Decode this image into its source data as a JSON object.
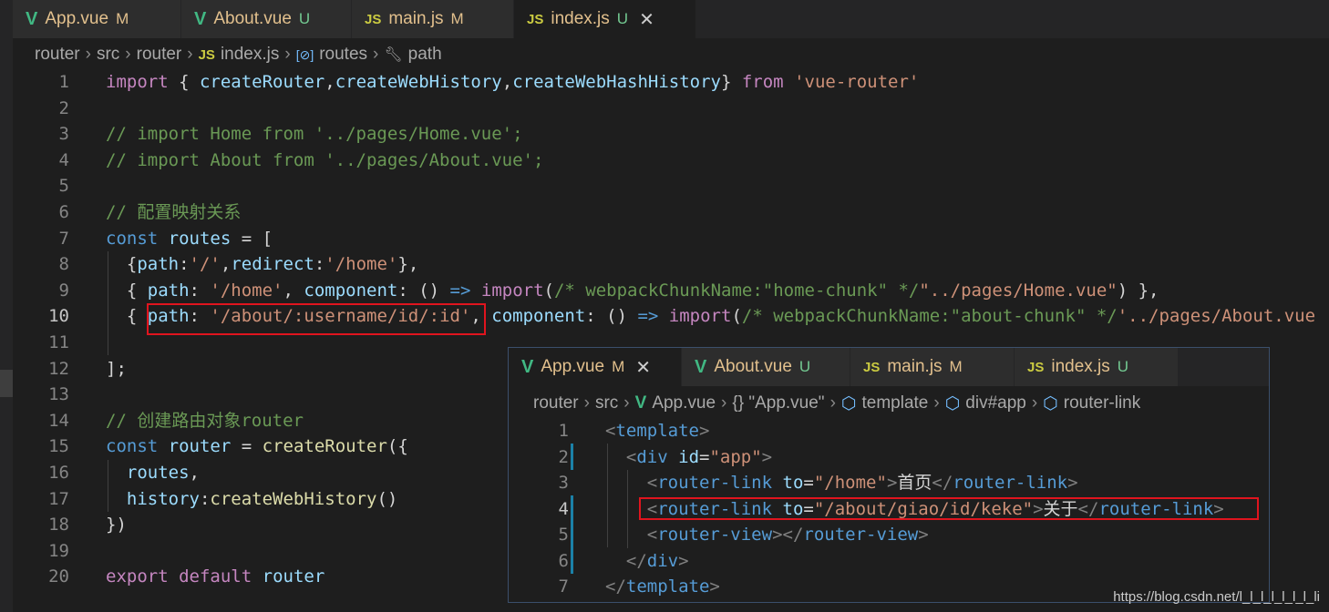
{
  "main_tabs": [
    {
      "icon": "V",
      "name": "App.vue",
      "status": "M"
    },
    {
      "icon": "V",
      "name": "About.vue",
      "status": "U"
    },
    {
      "icon": "JS",
      "name": "main.js",
      "status": "M"
    },
    {
      "icon": "JS",
      "name": "index.js",
      "status": "U",
      "close": "✕"
    }
  ],
  "main_breadcrumb": [
    "router",
    "src",
    "router",
    "index.js",
    "routes",
    "path"
  ],
  "main_code": [
    {
      "n": "1",
      "tokens": [
        [
          "k",
          "import"
        ],
        [
          "p",
          " { "
        ],
        [
          "v",
          "createRouter"
        ],
        [
          "p",
          ","
        ],
        [
          "v",
          "createWebHistory"
        ],
        [
          "p",
          ","
        ],
        [
          "v",
          "createWebHashHistory"
        ],
        [
          "p",
          "} "
        ],
        [
          "k",
          "from"
        ],
        [
          "p",
          " "
        ],
        [
          "s",
          "'vue-router'"
        ]
      ]
    },
    {
      "n": "2",
      "tokens": []
    },
    {
      "n": "3",
      "tokens": [
        [
          "c",
          "// import Home from '../pages/Home.vue';"
        ]
      ]
    },
    {
      "n": "4",
      "tokens": [
        [
          "c",
          "// import About from '../pages/About.vue';"
        ]
      ]
    },
    {
      "n": "5",
      "tokens": []
    },
    {
      "n": "6",
      "tokens": [
        [
          "c",
          "// 配置映射关系"
        ]
      ]
    },
    {
      "n": "7",
      "tokens": [
        [
          "kb",
          "const"
        ],
        [
          "p",
          " "
        ],
        [
          "v",
          "routes"
        ],
        [
          "p",
          " = ["
        ]
      ]
    },
    {
      "n": "8",
      "tokens": [
        [
          "p",
          "  {"
        ],
        [
          "v",
          "path"
        ],
        [
          "p",
          ":"
        ],
        [
          "s",
          "'/'"
        ],
        [
          "p",
          ","
        ],
        [
          "v",
          "redirect"
        ],
        [
          "p",
          ":"
        ],
        [
          "s",
          "'/home'"
        ],
        [
          "p",
          "},"
        ]
      ]
    },
    {
      "n": "9",
      "tokens": [
        [
          "p",
          "  { "
        ],
        [
          "v",
          "path"
        ],
        [
          "p",
          ": "
        ],
        [
          "s",
          "'/home'"
        ],
        [
          "p",
          ", "
        ],
        [
          "v",
          "component"
        ],
        [
          "p",
          ": () "
        ],
        [
          "kb",
          "=>"
        ],
        [
          "p",
          " "
        ],
        [
          "k",
          "import"
        ],
        [
          "p",
          "("
        ],
        [
          "c",
          "/* webpackChunkName:\"home-chunk\" */"
        ],
        [
          "s",
          "\"../pages/Home.vue\""
        ],
        [
          "p",
          ") },"
        ]
      ]
    },
    {
      "n": "10",
      "tokens": [
        [
          "p",
          "  { "
        ],
        [
          "v",
          "path"
        ],
        [
          "p",
          ": "
        ],
        [
          "s",
          "'/about/:username/id/:id'"
        ],
        [
          "p",
          ", "
        ],
        [
          "v",
          "component"
        ],
        [
          "p",
          ": () "
        ],
        [
          "kb",
          "=>"
        ],
        [
          "p",
          " "
        ],
        [
          "k",
          "import"
        ],
        [
          "p",
          "("
        ],
        [
          "c",
          "/* webpackChunkName:\"about-chunk\" */"
        ],
        [
          "s",
          "'../pages/About.vue"
        ]
      ]
    },
    {
      "n": "11",
      "tokens": []
    },
    {
      "n": "12",
      "tokens": [
        [
          "p",
          "];"
        ]
      ]
    },
    {
      "n": "13",
      "tokens": []
    },
    {
      "n": "14",
      "tokens": [
        [
          "c",
          "// 创建路由对象router"
        ]
      ]
    },
    {
      "n": "15",
      "tokens": [
        [
          "kb",
          "const"
        ],
        [
          "p",
          " "
        ],
        [
          "v",
          "router"
        ],
        [
          "p",
          " = "
        ],
        [
          "f",
          "createRouter"
        ],
        [
          "p",
          "({"
        ]
      ]
    },
    {
      "n": "16",
      "tokens": [
        [
          "p",
          "  "
        ],
        [
          "v",
          "routes"
        ],
        [
          "p",
          ","
        ]
      ]
    },
    {
      "n": "17",
      "tokens": [
        [
          "p",
          "  "
        ],
        [
          "v",
          "history"
        ],
        [
          "p",
          ":"
        ],
        [
          "f",
          "createWebHistory"
        ],
        [
          "p",
          "()"
        ]
      ]
    },
    {
      "n": "18",
      "tokens": [
        [
          "p",
          "})"
        ]
      ]
    },
    {
      "n": "19",
      "tokens": []
    },
    {
      "n": "20",
      "tokens": [
        [
          "k",
          "export"
        ],
        [
          "p",
          " "
        ],
        [
          "k",
          "default"
        ],
        [
          "p",
          " "
        ],
        [
          "v",
          "router"
        ]
      ]
    }
  ],
  "overlay_tabs": [
    {
      "icon": "V",
      "name": "App.vue",
      "status": "M",
      "close": "✕"
    },
    {
      "icon": "V",
      "name": "About.vue",
      "status": "U"
    },
    {
      "icon": "JS",
      "name": "main.js",
      "status": "M"
    },
    {
      "icon": "JS",
      "name": "index.js",
      "status": "U"
    }
  ],
  "overlay_breadcrumb": [
    "router",
    "src",
    "App.vue",
    "{} \"App.vue\"",
    "template",
    "div#app",
    "router-link"
  ],
  "overlay_code": [
    {
      "n": "1",
      "tokens": [
        [
          "g",
          "<"
        ],
        [
          "t",
          "template"
        ],
        [
          "g",
          ">"
        ]
      ]
    },
    {
      "n": "2",
      "tokens": [
        [
          "p",
          "  "
        ],
        [
          "g",
          "<"
        ],
        [
          "t",
          "div"
        ],
        [
          "p",
          " "
        ],
        [
          "a",
          "id"
        ],
        [
          "w",
          "="
        ],
        [
          "s",
          "\"app\""
        ],
        [
          "g",
          ">"
        ]
      ]
    },
    {
      "n": "3",
      "tokens": [
        [
          "p",
          "    "
        ],
        [
          "g",
          "<"
        ],
        [
          "t",
          "router-link"
        ],
        [
          "p",
          " "
        ],
        [
          "a",
          "to"
        ],
        [
          "w",
          "="
        ],
        [
          "s",
          "\"/home\""
        ],
        [
          "g",
          ">"
        ],
        [
          "w",
          "首页"
        ],
        [
          "g",
          "</"
        ],
        [
          "t",
          "router-link"
        ],
        [
          "g",
          ">"
        ]
      ]
    },
    {
      "n": "4",
      "tokens": [
        [
          "p",
          "    "
        ],
        [
          "g",
          "<"
        ],
        [
          "t",
          "router-link"
        ],
        [
          "p",
          " "
        ],
        [
          "a",
          "to"
        ],
        [
          "w",
          "="
        ],
        [
          "s",
          "\"/about/giao/id/keke\""
        ],
        [
          "g",
          ">"
        ],
        [
          "w",
          "关于"
        ],
        [
          "g",
          "</"
        ],
        [
          "t",
          "router-link"
        ],
        [
          "g",
          ">"
        ]
      ]
    },
    {
      "n": "5",
      "tokens": [
        [
          "p",
          "    "
        ],
        [
          "g",
          "<"
        ],
        [
          "t",
          "router-view"
        ],
        [
          "g",
          "></"
        ],
        [
          "t",
          "router-view"
        ],
        [
          "g",
          ">"
        ]
      ]
    },
    {
      "n": "6",
      "tokens": [
        [
          "p",
          "  "
        ],
        [
          "g",
          "</"
        ],
        [
          "t",
          "div"
        ],
        [
          "g",
          ">"
        ]
      ]
    },
    {
      "n": "7",
      "tokens": [
        [
          "g",
          "</"
        ],
        [
          "t",
          "template"
        ],
        [
          "g",
          ">"
        ]
      ]
    }
  ],
  "watermark": "https://blog.csdn.net/l_l_l_l_l_l_l_li"
}
